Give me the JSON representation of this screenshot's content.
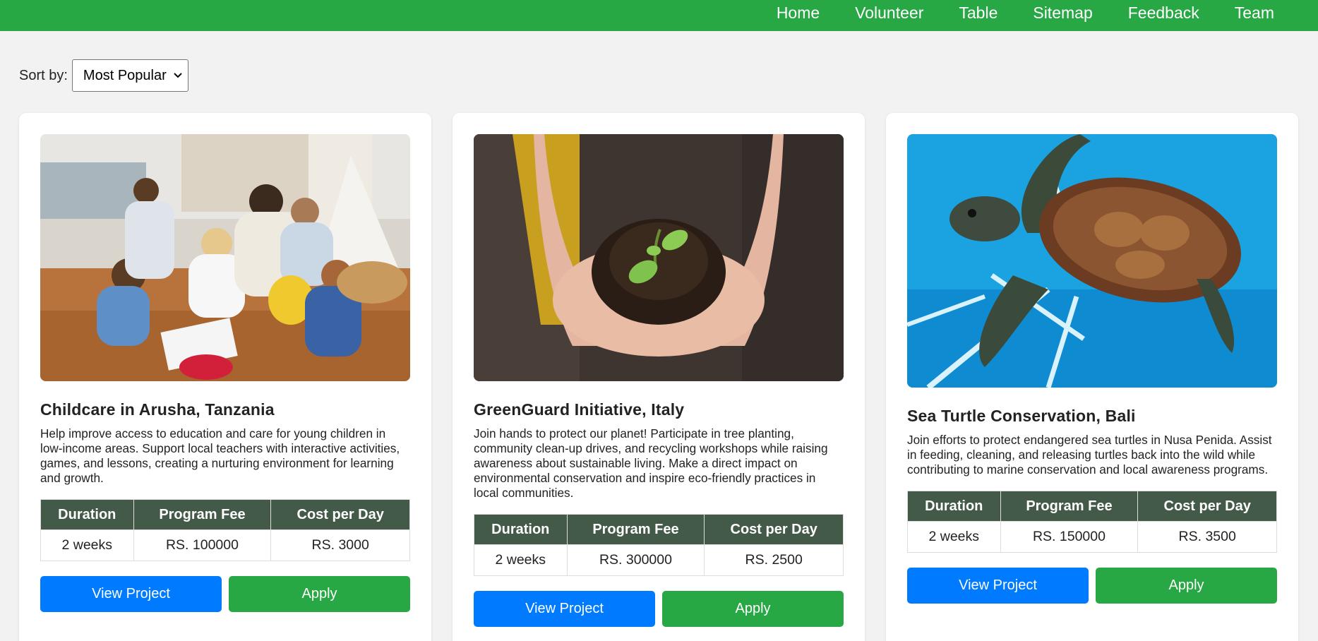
{
  "nav": {
    "items": [
      "Home",
      "Volunteer",
      "Table",
      "Sitemap",
      "Feedback",
      "Team"
    ]
  },
  "sort": {
    "label": "Sort by:",
    "selected": "Most Popular"
  },
  "table_headers": [
    "Duration",
    "Program Fee",
    "Cost per Day"
  ],
  "cards": [
    {
      "title": "Childcare in Arusha, Tanzania",
      "description": "Help improve access to education and care for young children in low-income areas. Support local teachers with interactive activities, games, and lessons, creating a nurturing environment for learning and growth.",
      "duration": "2 weeks",
      "fee": "RS. 100000",
      "cost_per_day": "RS. 3000",
      "view_label": "View Project",
      "apply_label": "Apply"
    },
    {
      "title": "GreenGuard Initiative, Italy",
      "description": "Join hands to protect our planet! Participate in tree planting, community clean-up drives, and recycling workshops while raising awareness about sustainable living. Make a direct impact on environmental conservation and inspire eco-friendly practices in local communities.",
      "duration": "2 weeks",
      "fee": "RS. 300000",
      "cost_per_day": "RS. 2500",
      "view_label": "View Project",
      "apply_label": "Apply"
    },
    {
      "title": "Sea Turtle Conservation, Bali",
      "description": "Join efforts to protect endangered sea turtles in Nusa Penida. Assist in feeding, cleaning, and releasing turtles back into the wild while contributing to marine conservation and local awareness programs.",
      "duration": "2 weeks",
      "fee": "RS. 150000",
      "cost_per_day": "RS. 3500",
      "view_label": "View Project",
      "apply_label": "Apply"
    }
  ],
  "colors": {
    "brand_green": "#28a745",
    "table_header": "#445a48",
    "button_blue": "#007bff"
  }
}
